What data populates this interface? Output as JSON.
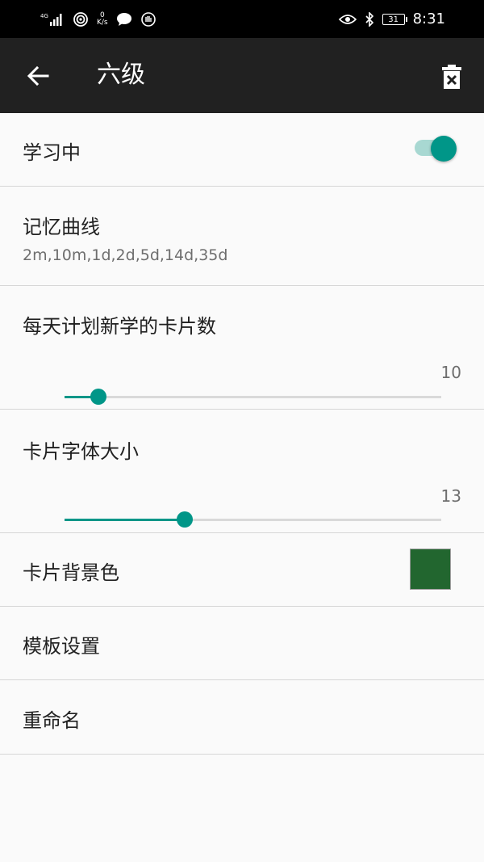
{
  "status_bar": {
    "network": "4G",
    "speed_value": "0",
    "speed_unit": "K/s",
    "battery": "31",
    "time": "8:31"
  },
  "app_bar": {
    "title": "六级",
    "back_icon": "arrow-left-icon",
    "delete_icon": "delete-icon"
  },
  "settings": {
    "learning": {
      "label": "学习中",
      "enabled": true
    },
    "memory_curve": {
      "label": "记忆曲线",
      "value": "2m,10m,1d,2d,5d,14d,35d"
    },
    "daily_new_cards": {
      "label": "每天计划新学的卡片数",
      "value": "10",
      "fraction": 0.09
    },
    "card_font_size": {
      "label": "卡片字体大小",
      "value": "13",
      "fraction": 0.32
    },
    "card_bg_color": {
      "label": "卡片背景色",
      "color": "#22662f"
    },
    "template_settings": {
      "label": "模板设置"
    },
    "rename": {
      "label": "重命名"
    }
  },
  "colors": {
    "accent": "#009688",
    "app_bar": "#212121",
    "background": "#fafafa"
  }
}
